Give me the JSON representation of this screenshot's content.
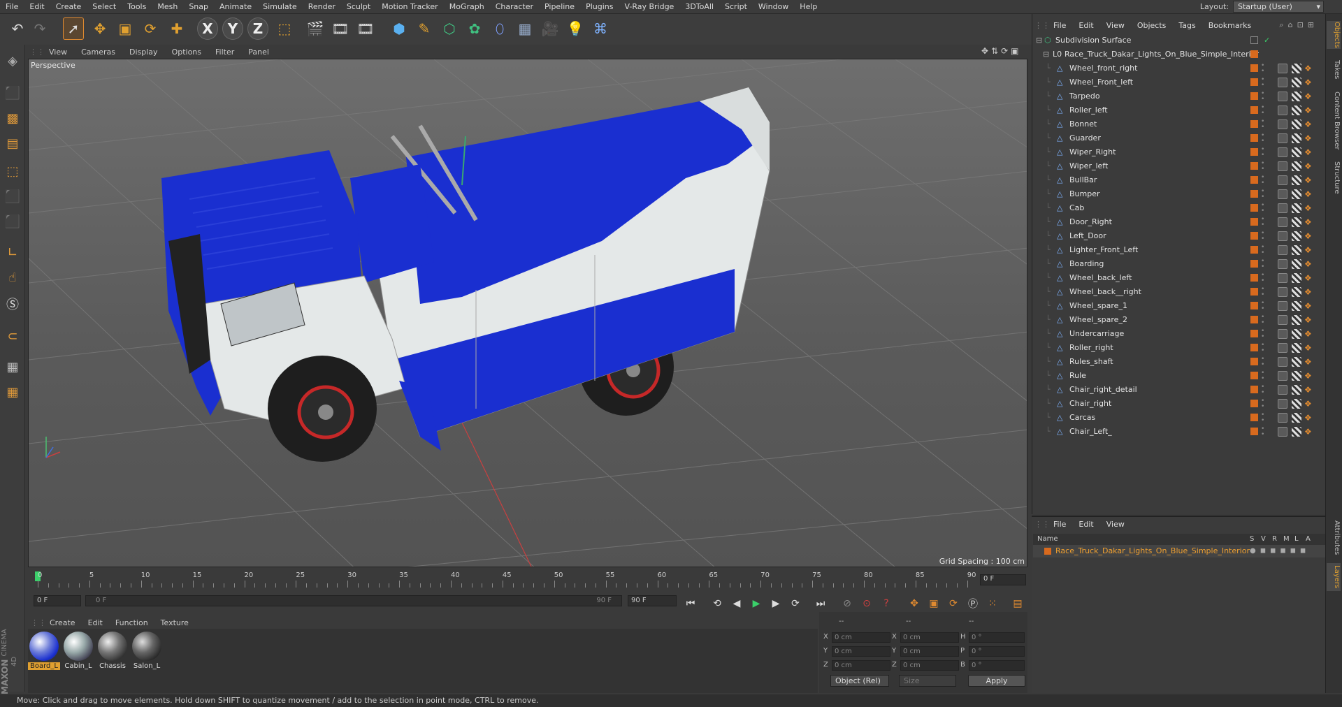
{
  "menu": [
    "File",
    "Edit",
    "Create",
    "Select",
    "Tools",
    "Mesh",
    "Snap",
    "Animate",
    "Simulate",
    "Render",
    "Sculpt",
    "Motion Tracker",
    "MoGraph",
    "Character",
    "Pipeline",
    "Plugins",
    "V-Ray Bridge",
    "3DToAll",
    "Script",
    "Window",
    "Help"
  ],
  "layout": {
    "label": "Layout:",
    "value": "Startup (User)"
  },
  "viewport": {
    "menu": [
      "View",
      "Cameras",
      "Display",
      "Options",
      "Filter",
      "Panel"
    ],
    "label": "Perspective",
    "grid_spacing": "Grid Spacing : 100 cm"
  },
  "timeline": {
    "ticks": [
      "0",
      "5",
      "10",
      "15",
      "20",
      "25",
      "30",
      "35",
      "40",
      "45",
      "50",
      "55",
      "60",
      "65",
      "70",
      "75",
      "80",
      "85",
      "90"
    ],
    "current_frame": "0 F",
    "start_field": "0 F",
    "range_start": "0 F",
    "range_end": "90 F",
    "end_field": "90 F"
  },
  "materials": {
    "menu": [
      "Create",
      "Edit",
      "Function",
      "Texture"
    ],
    "items": [
      {
        "label": "Board_L",
        "selected": true
      },
      {
        "label": "Cabin_L",
        "selected": false
      },
      {
        "label": "Chassis",
        "selected": false
      },
      {
        "label": "Salon_L",
        "selected": false
      }
    ]
  },
  "coords": {
    "headers": [
      "--",
      "--",
      "--"
    ],
    "rows": [
      {
        "a": "X",
        "av": "0 cm",
        "b": "X",
        "bv": "0 cm",
        "c": "H",
        "cv": "0 °"
      },
      {
        "a": "Y",
        "av": "0 cm",
        "b": "Y",
        "bv": "0 cm",
        "c": "P",
        "cv": "0 °"
      },
      {
        "a": "Z",
        "av": "0 cm",
        "b": "Z",
        "bv": "0 cm",
        "c": "B",
        "cv": "0 °"
      }
    ],
    "mode": "Object (Rel)",
    "size_mode": "Size",
    "apply": "Apply"
  },
  "status": "Move: Click and drag to move elements. Hold down SHIFT to quantize movement / add to the selection in point mode, CTRL to remove.",
  "logo": {
    "line1": "MAXON",
    "line2": "CINEMA 4D"
  },
  "object_manager": {
    "menu": [
      "File",
      "Edit",
      "View",
      "Objects",
      "Tags",
      "Bookmarks"
    ],
    "root": "Subdivision Surface",
    "group": "Race_Truck_Dakar_Lights_On_Blue_Simple_Interior",
    "children": [
      "Wheel_front_right",
      "Wheel_Front_left",
      "Tarpedo",
      "Roller_left",
      "Bonnet",
      "Guarder",
      "Wiper_Right",
      "Wiper_left",
      "BullBar",
      "Bumper",
      "Cab",
      "Door_Right",
      "Left_Door",
      "Lighter_Front_Left",
      "Boarding",
      "Wheel_back_left",
      "Wheel_back__right",
      "Wheel_spare_1",
      "Wheel_spare_2",
      "Undercarriage",
      "Roller_right",
      "Rules_shaft",
      "Rule",
      "Chair_right_detail",
      "Chair_right",
      "Carcas",
      "Chair_Left_"
    ]
  },
  "layer_manager": {
    "menu": [
      "File",
      "Edit",
      "View"
    ],
    "columns": [
      "Name",
      "S",
      "V",
      "R",
      "M",
      "L",
      "A"
    ],
    "row": "Race_Truck_Dakar_Lights_On_Blue_Simple_Interior"
  },
  "right_tabs": [
    "Objects",
    "Takes",
    "Content Browser",
    "Structure",
    "Attributes",
    "Layers"
  ],
  "colors": {
    "accent": "#e08a30",
    "truck_blue": "#1a2fd0",
    "truck_white": "#e4e8e8",
    "wheel_red": "#c62828"
  }
}
